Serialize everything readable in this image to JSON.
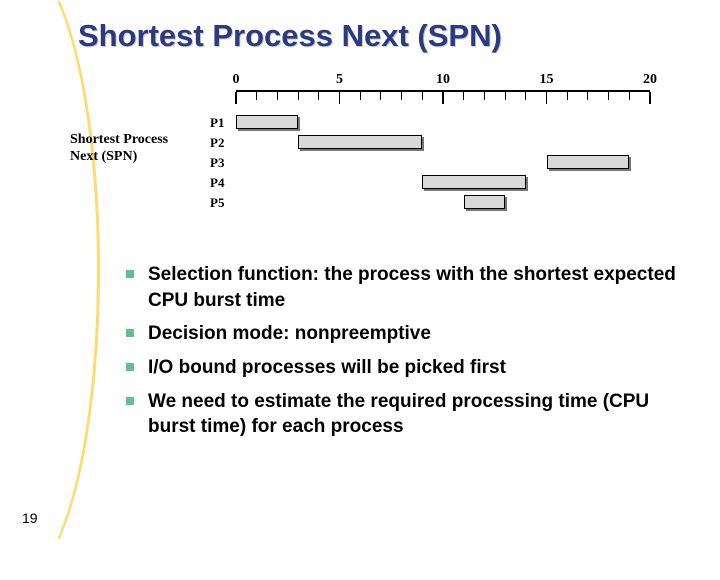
{
  "title": "Shortest Process Next (SPN)",
  "left_label_line1": "Shortest Process",
  "left_label_line2": "Next (SPN)",
  "page_number": "19",
  "bullets": [
    "Selection function: the process with the shortest expected CPU burst time",
    "Decision mode: nonpreemptive",
    "I/O bound processes will be picked first",
    "We need to estimate the required processing time (CPU burst time) for each process"
  ],
  "chart_data": {
    "type": "bar",
    "title": "",
    "xlabel": "",
    "ylabel": "",
    "axis_ticks": [
      "0",
      "5",
      "10",
      "15",
      "20"
    ],
    "xlim": [
      0,
      20
    ],
    "categories": [
      "P1",
      "P2",
      "P3",
      "P4",
      "P5"
    ],
    "series": [
      {
        "name": "P1",
        "start": 0,
        "end": 3
      },
      {
        "name": "P2",
        "start": 3,
        "end": 9
      },
      {
        "name": "P3",
        "start": 15,
        "end": 19
      },
      {
        "name": "P4",
        "start": 9,
        "end": 14
      },
      {
        "name": "P5",
        "start": 11,
        "end": 13
      }
    ]
  }
}
